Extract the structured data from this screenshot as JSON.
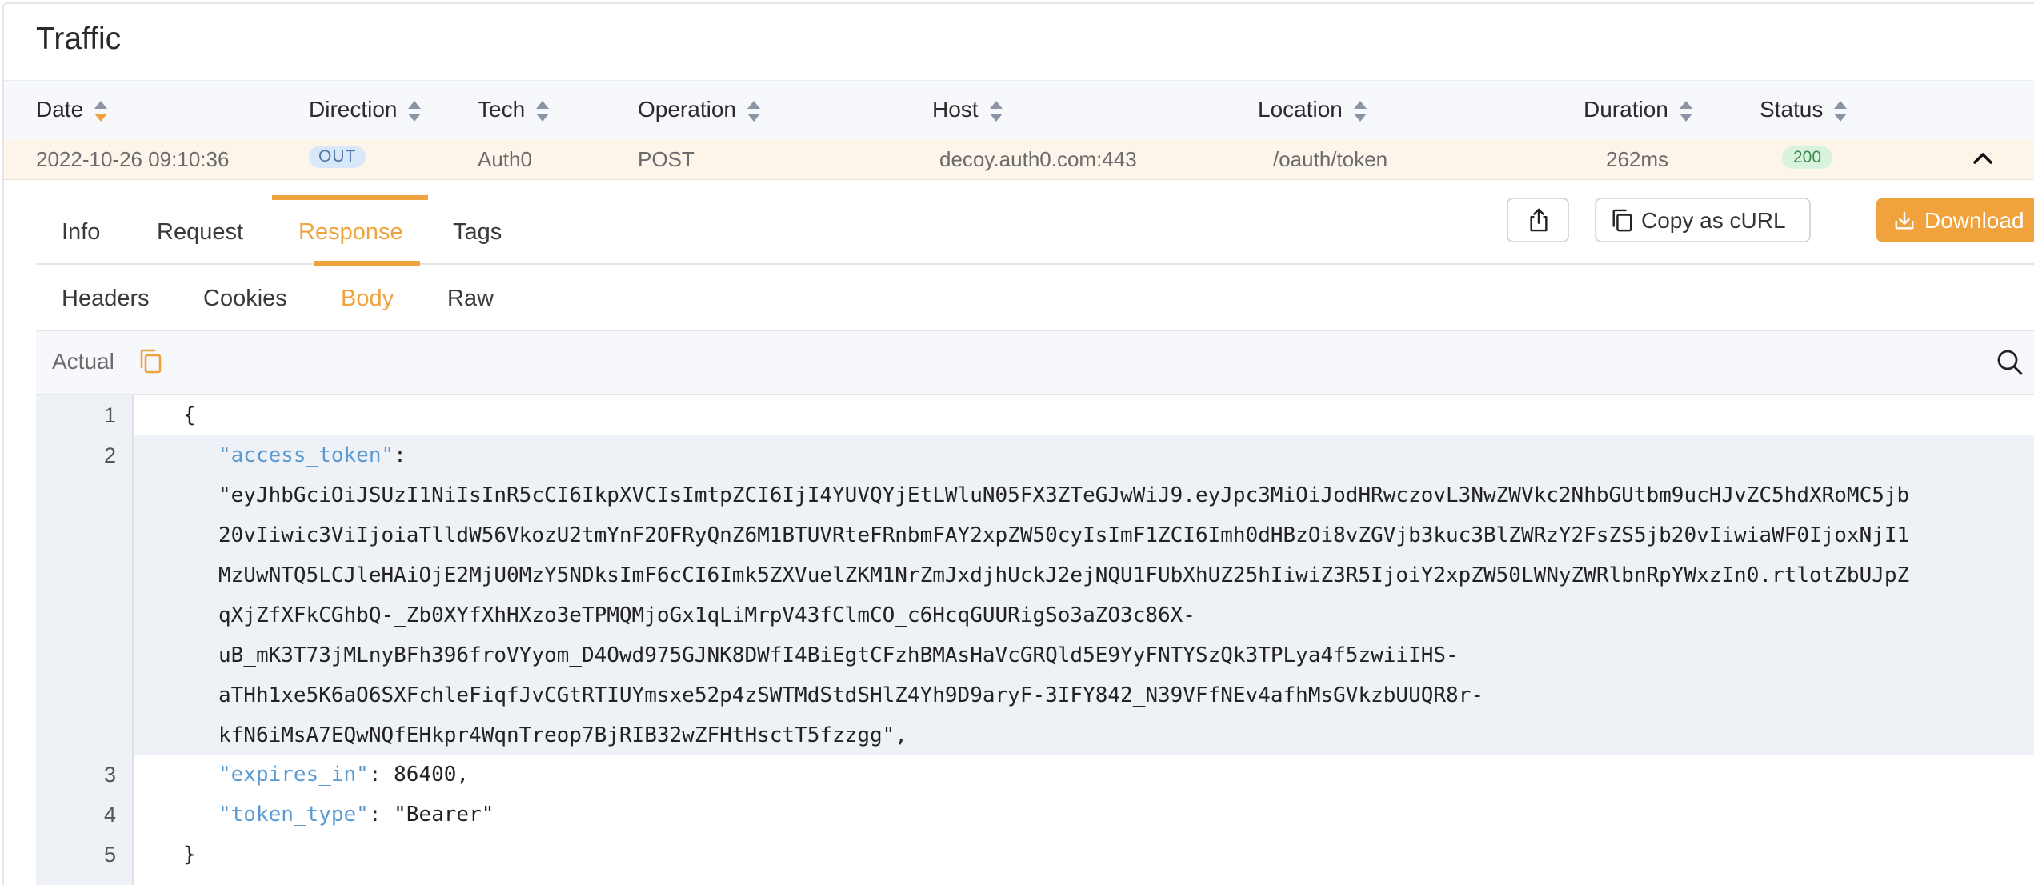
{
  "title": "Traffic",
  "columns": [
    "Date",
    "Direction",
    "Tech",
    "Operation",
    "Host",
    "Location",
    "Duration",
    "Status"
  ],
  "row": {
    "date": "2022-10-26 09:10:36",
    "direction": "OUT",
    "tech": "Auth0",
    "operation": "POST",
    "host": "decoy.auth0.com:443",
    "location": "/oauth/token",
    "duration": "262ms",
    "status": "200"
  },
  "detail_tabs": [
    "Info",
    "Request",
    "Response",
    "Tags"
  ],
  "active_detail_tab": "Response",
  "actions": {
    "share_icon": "share-icon",
    "copy_curl": "Copy as cURL",
    "download": "Download"
  },
  "body_tabs": [
    "Headers",
    "Cookies",
    "Body",
    "Raw"
  ],
  "active_body_tab": "Body",
  "actual_label": "Actual",
  "line_numbers": [
    "1",
    "2",
    "3",
    "4",
    "5"
  ],
  "code": {
    "open_brace": "{",
    "access_token_key": "\"access_token\"",
    "colon": ":",
    "access_token_lines": [
      "\"eyJhbGciOiJSUzI1NiIsInR5cCI6IkpXVCIsImtpZCI6IjI4YUVQYjEtLWluN05FX3ZTeGJwWiJ9.eyJpc3MiOiJodHRwczovL3NwZWVkc2NhbGUtbm9ucHJvZC5hdXRoMC5jb",
      "20vIiwic3ViIjoiaTlldW56VkozU2tmYnF2OFRyQnZ6M1BTUVRteFRnbmFAY2xpZW50cyIsImF1ZCI6Imh0dHBzOi8vZGVjb3kuc3BlZWRzY2FsZS5jb20vIiwiaWF0IjoxNjI1",
      "MzUwNTQ5LCJleHAiOjE2MjU0MzY5NDksImF6cCI6Imk5ZXVuelZKM1NrZmJxdjhUckJ2ejNQU1FUbXhUZ25hIiwiZ3R5IjoiY2xpZW50LWNyZWRlbnRpYWxzIn0.rtlotZbUJpZ",
      "qXjZfXFkCGhbQ-_Zb0XYfXhHXzo3eTPMQMjoGx1qLiMrpV43fClmCO_c6HcqGUURigSo3aZO3c86X-",
      "uB_mK3T73jMLnyBFh396froVYyom_D4Owd975GJNK8DWfI4BiEgtCFzhBMAsHaVcGRQld5E9YyFNTYSzQk3TPLya4f5zwiiIHS-",
      "aTHh1xe5K6aO6SXFchleFiqfJvCGtRTIUYmsxe52p4zSWTMdStdSHlZ4Yh9D9aryF-3IFY842_N39VFfNEv4afhMsGVkzbUUQR8r-",
      "kfN6iMsA7EQwNQfEHkpr4WqnTreop7BjRIB32wZFHtHsctT5fzzgg\","
    ],
    "expires_in_key": "\"expires_in\"",
    "expires_in_value": ": 86400,",
    "token_type_key": "\"token_type\"",
    "token_type_value": ": \"Bearer\"",
    "close_brace": "}"
  },
  "colors": {
    "accent": "#f0a23c",
    "json_key": "#5b9bd1",
    "row_highlight": "#fdf5ea",
    "out_badge_bg": "#d8e8f8",
    "status_badge_bg": "#d8f2dd"
  }
}
